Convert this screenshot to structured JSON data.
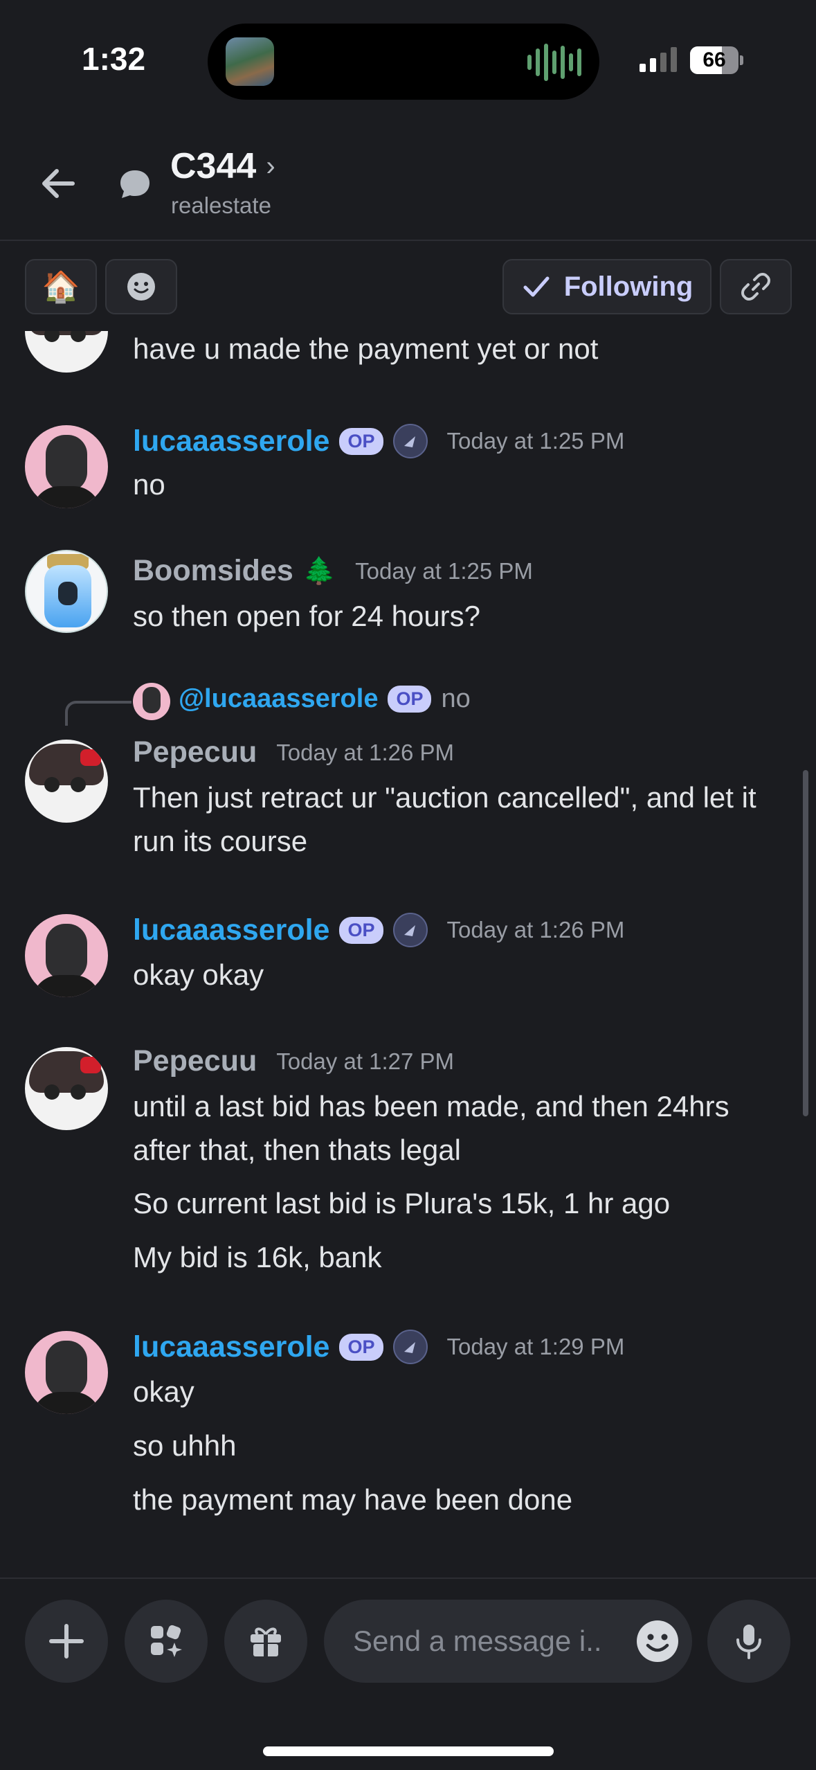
{
  "status_bar": {
    "time": "1:32",
    "battery": "66",
    "battery_level": 0.66
  },
  "header": {
    "title": "C344",
    "subtitle": "realestate"
  },
  "toolbar": {
    "house_emoji": "🏠",
    "following_label": "Following"
  },
  "messages": [
    {
      "text": "have u made the payment yet or not"
    },
    {
      "author": "lucaaasserole",
      "badge": "OP",
      "time": "Today at 1:25 PM",
      "lines": [
        "no"
      ]
    },
    {
      "author": "Boomsides",
      "author_emoji": "🌲",
      "time": "Today at 1:25 PM",
      "lines": [
        "so then open for 24 hours?"
      ]
    },
    {
      "reply": {
        "mention": "@lucaaasserole",
        "badge": "OP",
        "text": "no"
      },
      "author": "Pepecuu",
      "time": "Today at 1:26 PM",
      "lines": [
        "Then just retract ur \"auction cancelled\", and let it run its course"
      ]
    },
    {
      "author": "lucaaasserole",
      "badge": "OP",
      "time": "Today at 1:26 PM",
      "lines": [
        "okay okay"
      ]
    },
    {
      "author": "Pepecuu",
      "time": "Today at 1:27 PM",
      "lines": [
        "until a last bid has been made, and then 24hrs after that, then thats legal",
        "So current last bid is Plura's 15k, 1 hr ago",
        "My bid is 16k, bank"
      ]
    },
    {
      "author": "lucaaasserole",
      "badge": "OP",
      "time": "Today at 1:29 PM",
      "lines": [
        "okay",
        "so uhhh",
        "the payment may have been done"
      ]
    }
  ],
  "composer": {
    "placeholder": "Send a message i.."
  },
  "colors": {
    "background": "#1b1c20",
    "name_blue": "#2fa7f0",
    "op_badge": "#c9cdfb",
    "following_text": "#c9cdfb"
  }
}
